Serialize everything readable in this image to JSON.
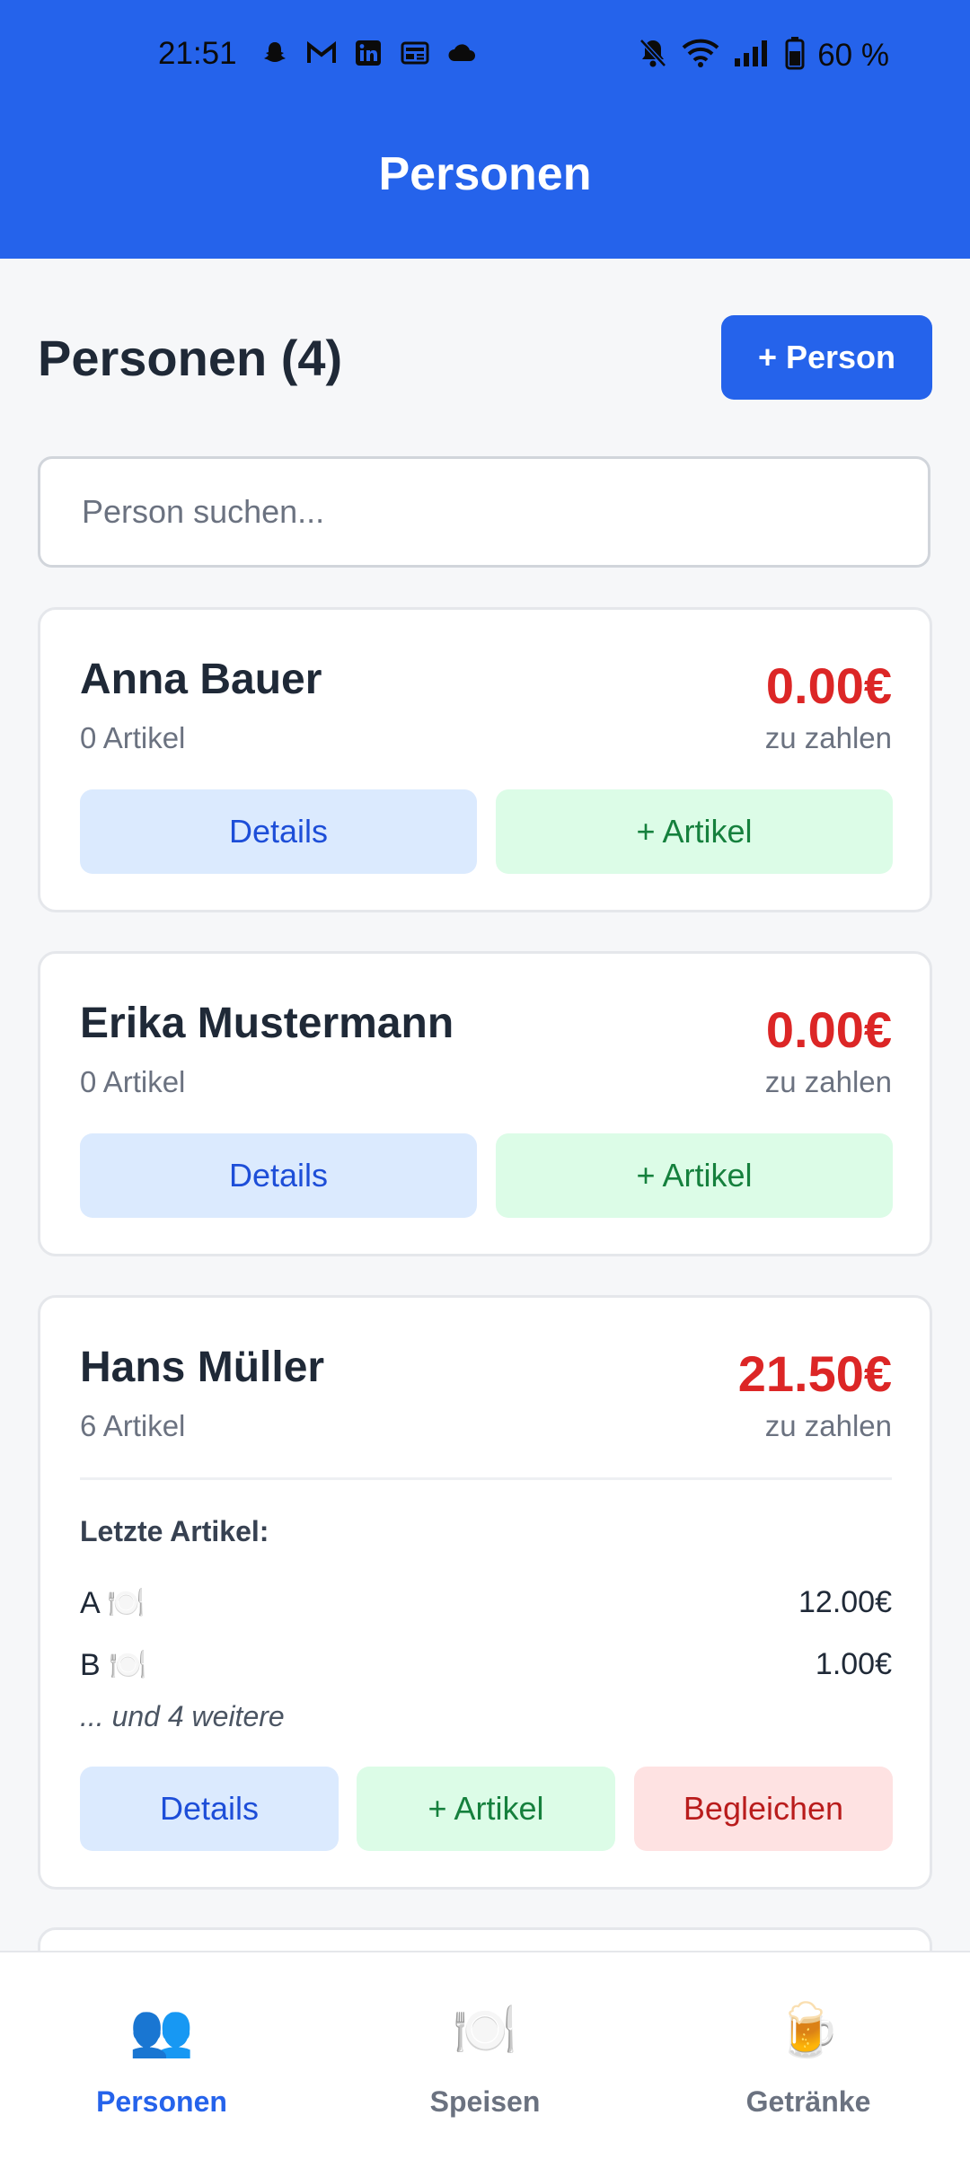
{
  "status_bar": {
    "time": "21:51",
    "left_icons": [
      "snapchat-icon",
      "gmail-icon",
      "linkedin-icon",
      "news-icon",
      "cloud-icon"
    ],
    "right_icons": [
      "muted-bell-icon",
      "wifi-icon",
      "signal-icon",
      "battery-icon"
    ],
    "battery": "60 %"
  },
  "app_bar": {
    "title": "Personen"
  },
  "header": {
    "heading": "Personen (4)",
    "add_person_label": "+ Person"
  },
  "search": {
    "placeholder": "Person suchen...",
    "value": ""
  },
  "persons": [
    {
      "name": "Anna Bauer",
      "count": "0 Artikel",
      "amount": "0.00€",
      "due_label": "zu zahlen",
      "details_label": "Details",
      "add_item_label": "+ Artikel"
    },
    {
      "name": "Erika Mustermann",
      "count": "0 Artikel",
      "amount": "0.00€",
      "due_label": "zu zahlen",
      "details_label": "Details",
      "add_item_label": "+ Artikel"
    },
    {
      "name": "Hans Müller",
      "count": "6 Artikel",
      "amount": "21.50€",
      "due_label": "zu zahlen",
      "recent_title": "Letzte Artikel:",
      "recent_items": [
        {
          "name": "A 🍽️",
          "price": "12.00€"
        },
        {
          "name": "B 🍽️",
          "price": "1.00€"
        }
      ],
      "more": "... und 4 weitere",
      "details_label": "Details",
      "add_item_label": "+ Artikel",
      "settle_label": "Begleichen"
    }
  ],
  "bottom_nav": [
    {
      "icon": "👥",
      "icon_name": "people-icon",
      "label": "Personen",
      "active": true
    },
    {
      "icon": "🍽️",
      "icon_name": "plate-icon",
      "label": "Speisen",
      "active": false
    },
    {
      "icon": "🍺",
      "icon_name": "beer-icon",
      "label": "Getränke",
      "active": false
    }
  ],
  "colors": {
    "primary": "#2563eb",
    "amount": "#dc2626",
    "details_bg": "#dbeafe",
    "artikel_bg": "#dcfce7",
    "settle_bg": "#fee2e2"
  }
}
